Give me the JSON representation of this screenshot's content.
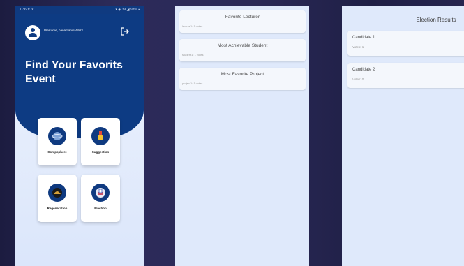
{
  "home": {
    "status_left": "1:36 ✕ ✕",
    "status_right": "▾ ◈ 39 ◢ 93% ▪",
    "welcome": "Welcome, hanamanisa0963",
    "title": "Find Your Favorits Event",
    "cards": [
      {
        "label": "Compsphere",
        "icon": "globe-icon"
      },
      {
        "label": "Suggestion",
        "icon": "medal-icon"
      },
      {
        "label": "Regeneration",
        "icon": "dome-icon"
      },
      {
        "label": "Election",
        "icon": "ballot-icon"
      }
    ]
  },
  "favorites": {
    "items": [
      {
        "title": "Favorite Lecturer",
        "subtitle": "lecture1: 1 votes"
      },
      {
        "title": "Most Achievable Student",
        "subtitle": "student1: 1 votes"
      },
      {
        "title": "Most Favorite Project",
        "subtitle": "project1: 1 votes"
      }
    ]
  },
  "election": {
    "title": "Election Results",
    "candidates": [
      {
        "name": "Candidate 1",
        "votes": "Votes: 1"
      },
      {
        "name": "Candidate 2",
        "votes": "Votes: 0"
      }
    ]
  },
  "colors": {
    "primary": "#0d3b83",
    "background": "#dfe9fb"
  }
}
